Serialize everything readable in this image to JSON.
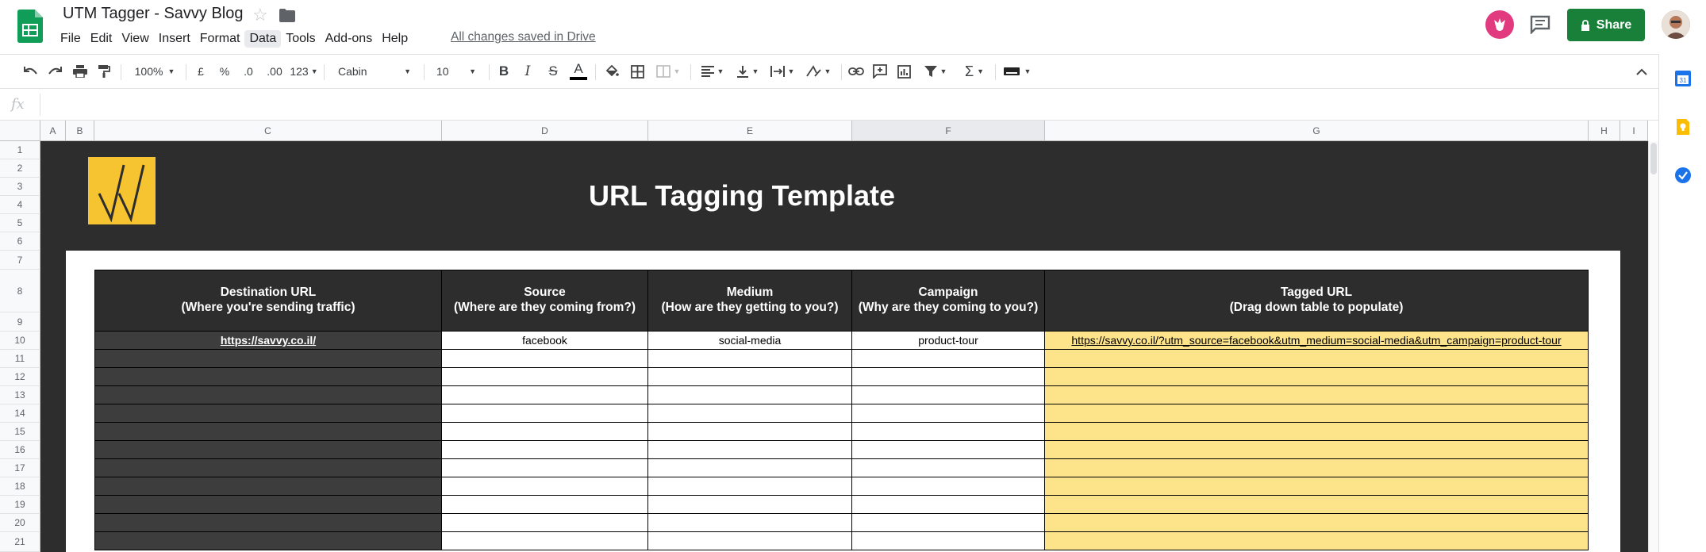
{
  "app": {
    "doc_title": "UTM Tagger - Savvy Blog",
    "save_status": "All changes saved in Drive",
    "share_label": "Share"
  },
  "menu": [
    "File",
    "Edit",
    "View",
    "Insert",
    "Format",
    "Data",
    "Tools",
    "Add-ons",
    "Help"
  ],
  "menu_active": "Data",
  "toolbar": {
    "zoom": "100%",
    "currency": "£",
    "percent": "%",
    "decrease_decimal": ".0",
    "increase_decimal": ".00",
    "more_formats": "123",
    "font": "Cabin",
    "font_size": "10",
    "bold": "B",
    "italic": "I",
    "strike": "S",
    "text_color_glyph": "A"
  },
  "formula_bar": {
    "fx": "fx",
    "value": ""
  },
  "columns": [
    "A",
    "B",
    "C",
    "D",
    "E",
    "F",
    "G",
    "H",
    "I"
  ],
  "selected_column": "F",
  "rows": [
    "1",
    "2",
    "3",
    "4",
    "5",
    "6",
    "7",
    "8",
    "9",
    "10",
    "11",
    "12",
    "13",
    "14",
    "15",
    "16",
    "17",
    "18",
    "19",
    "20",
    "21"
  ],
  "sheet": {
    "title": "URL Tagging Template",
    "headers": [
      {
        "line1": "Destination URL",
        "line2": "(Where you're sending traffic)"
      },
      {
        "line1": "Source",
        "line2": "(Where are they coming from?)"
      },
      {
        "line1": "Medium",
        "line2": "(How are they getting to you?)"
      },
      {
        "line1": "Campaign",
        "line2": "(Why are they coming to you?)"
      },
      {
        "line1": "Tagged URL",
        "line2": "(Drag down table to populate)"
      }
    ],
    "data_rows": [
      [
        "https://savvy.co.il/",
        "facebook",
        "social-media",
        "product-tour",
        "https://savvy.co.il/?utm_source=facebook&utm_medium=social-media&utm_campaign=product-tour"
      ],
      [
        "",
        "",
        "",
        "",
        ""
      ],
      [
        "",
        "",
        "",
        "",
        ""
      ],
      [
        "",
        "",
        "",
        "",
        ""
      ],
      [
        "",
        "",
        "",
        "",
        ""
      ],
      [
        "",
        "",
        "",
        "",
        ""
      ],
      [
        "",
        "",
        "",
        "",
        ""
      ],
      [
        "",
        "",
        "",
        "",
        ""
      ],
      [
        "",
        "",
        "",
        "",
        ""
      ],
      [
        "",
        "",
        "",
        "",
        ""
      ],
      [
        "",
        "",
        "",
        "",
        ""
      ],
      [
        "",
        "",
        "",
        "",
        ""
      ]
    ]
  },
  "colors": {
    "sheet_dark": "#2d2d2d",
    "column_c_dark": "#3d3d3d",
    "tagged_url_fill": "#fde38a",
    "logo_yellow": "#f6c431",
    "share_green": "#188038"
  }
}
